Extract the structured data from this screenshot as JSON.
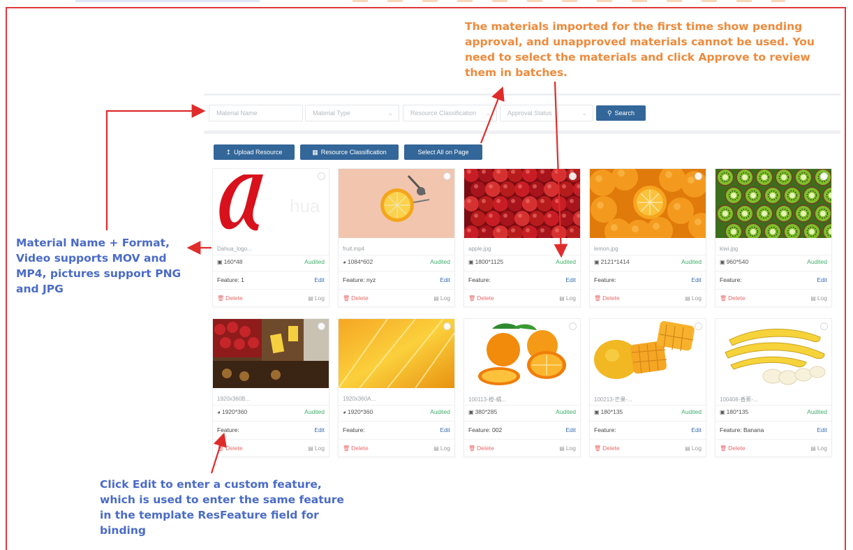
{
  "notes": {
    "approval": [
      "The materials imported for the first time show pending",
      "approval, and unapproved materials cannot be used. You",
      "need to select the materials and click Approve to review",
      "them in batches."
    ],
    "material_name": [
      "Material Name + Format,",
      "Video supports MOV and",
      "MP4, pictures support PNG",
      "and JPG"
    ],
    "edit": [
      "Click Edit to enter a custom feature,",
      "which is used to enter the same feature",
      "in the template ResFeature field for",
      "binding"
    ]
  },
  "search": {
    "material_name_placeholder": "Material Name",
    "material_type_placeholder": "Material Type",
    "resource_classification_placeholder": "Resource Classification",
    "approval_status_placeholder": "Approval Status",
    "search_label": "Search"
  },
  "toolbar": {
    "upload_label": "Upload Resource",
    "classification_label": "Resource Classification",
    "select_all_label": "Select All on Page"
  },
  "card_labels": {
    "edit": "Edit",
    "delete": "Delete",
    "log": "Log"
  },
  "cards": [
    {
      "name": "Dahua_logo...",
      "size": "160*48",
      "type": "image",
      "status": "Audited",
      "feature": "Feature: 1",
      "thumb": "logo"
    },
    {
      "name": "fruit.mp4",
      "size": "1084*602",
      "type": "video",
      "status": "Audited",
      "feature": "Feature: nyz",
      "thumb": "juicer"
    },
    {
      "name": "apple.jpg",
      "size": "1800*1125",
      "type": "image",
      "status": "Audited",
      "feature": "Feature:",
      "thumb": "apples"
    },
    {
      "name": "lemon.jpg",
      "size": "2121*1414",
      "type": "image",
      "status": "Audited",
      "feature": "Feature:",
      "thumb": "oranges"
    },
    {
      "name": "kiwi.jpg",
      "size": "960*540",
      "type": "image",
      "status": "Audited",
      "feature": "Feature:",
      "thumb": "kiwi"
    },
    {
      "name": "1920x360B...",
      "size": "1920*360",
      "type": "video",
      "status": "Audited",
      "feature": "Feature:",
      "thumb": "market"
    },
    {
      "name": "1920x360A...",
      "size": "1920*360",
      "type": "video",
      "status": "Audited",
      "feature": "Feature:",
      "thumb": "citrus"
    },
    {
      "name": "100113-橙-橘...",
      "size": "380*285",
      "type": "image",
      "status": "Audited",
      "feature": "Feature: 002",
      "thumb": "orange-cut"
    },
    {
      "name": "100213-芒果-...",
      "size": "180*135",
      "type": "image",
      "status": "Audited",
      "feature": "Feature:",
      "thumb": "mango"
    },
    {
      "name": "100408-香蕉-...",
      "size": "180*135",
      "type": "image",
      "status": "Audited",
      "feature": "Feature: Banana",
      "thumb": "banana"
    }
  ],
  "colors": {
    "frame": "#e0393b",
    "note_orange": "#ee8a3c",
    "note_blue": "#4a6bc7",
    "arrow": "#e02b2b",
    "primary_button": "#336699",
    "audited": "#3fae6a",
    "edit": "#3a6fb0",
    "delete": "#e86a6a"
  }
}
